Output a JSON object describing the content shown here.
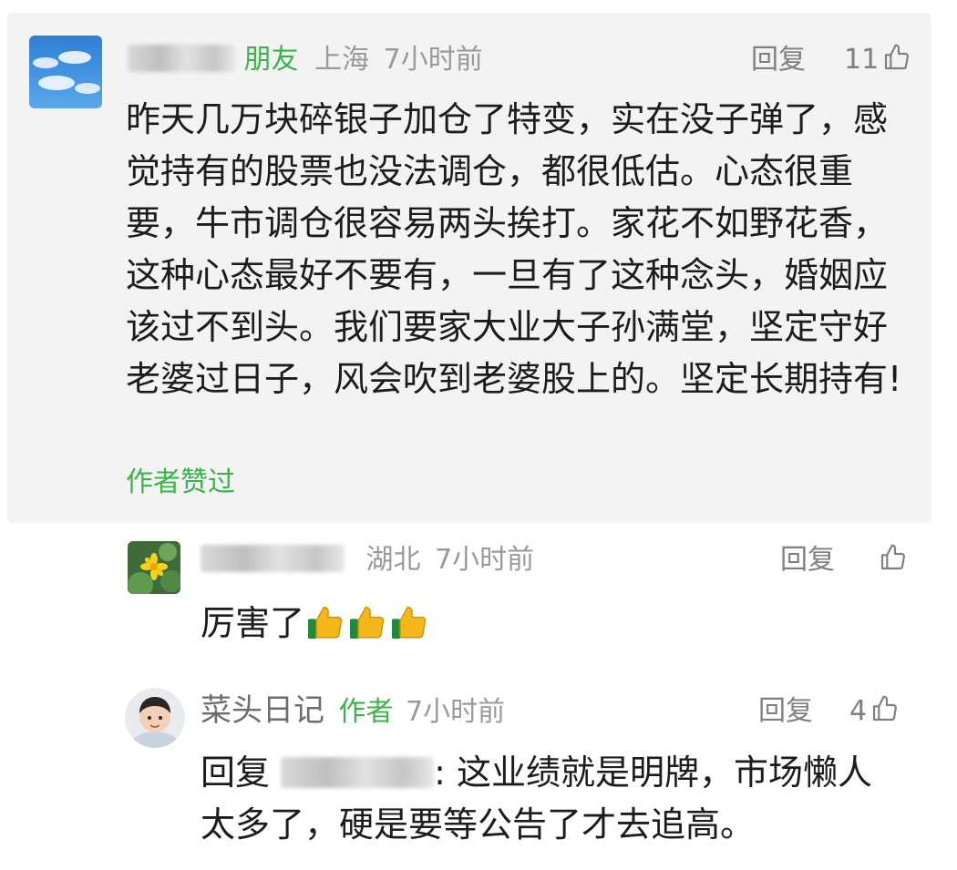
{
  "comment1": {
    "badge": "朋友",
    "location": "上海",
    "time": "7小时前",
    "reply_label": "回复",
    "like_count": "11",
    "text": "昨天几万块碎银子加仓了特变，实在没子弹了，感觉持有的股票也没法调仓，都很低估。心态很重要，牛市调仓很容易两头挨打。家花不如野花香，这种心态最好不要有，一旦有了这种念头，婚姻应该过不到头。我们要家大业大子孙满堂，坚定守好老婆过日子，风会吹到老婆股上的。坚定长期持有!",
    "author_liked": "作者赞过"
  },
  "comment2": {
    "location": "湖北",
    "time": "7小时前",
    "reply_label": "回复",
    "text": "厉害了",
    "emoji_icon": "thumbs-up-emoji"
  },
  "comment3": {
    "username": "菜头日记",
    "badge": "作者",
    "time": "7小时前",
    "reply_label": "回复",
    "like_count": "4",
    "reply_prefix": "回复",
    "text": "这业绩就是明牌，市场懒人太多了，硬是要等公告了才去追高。"
  },
  "colors": {
    "accent_green": "#3bb34a",
    "meta_gray": "#9a9a9a",
    "card_bg": "#f3f3f3"
  }
}
